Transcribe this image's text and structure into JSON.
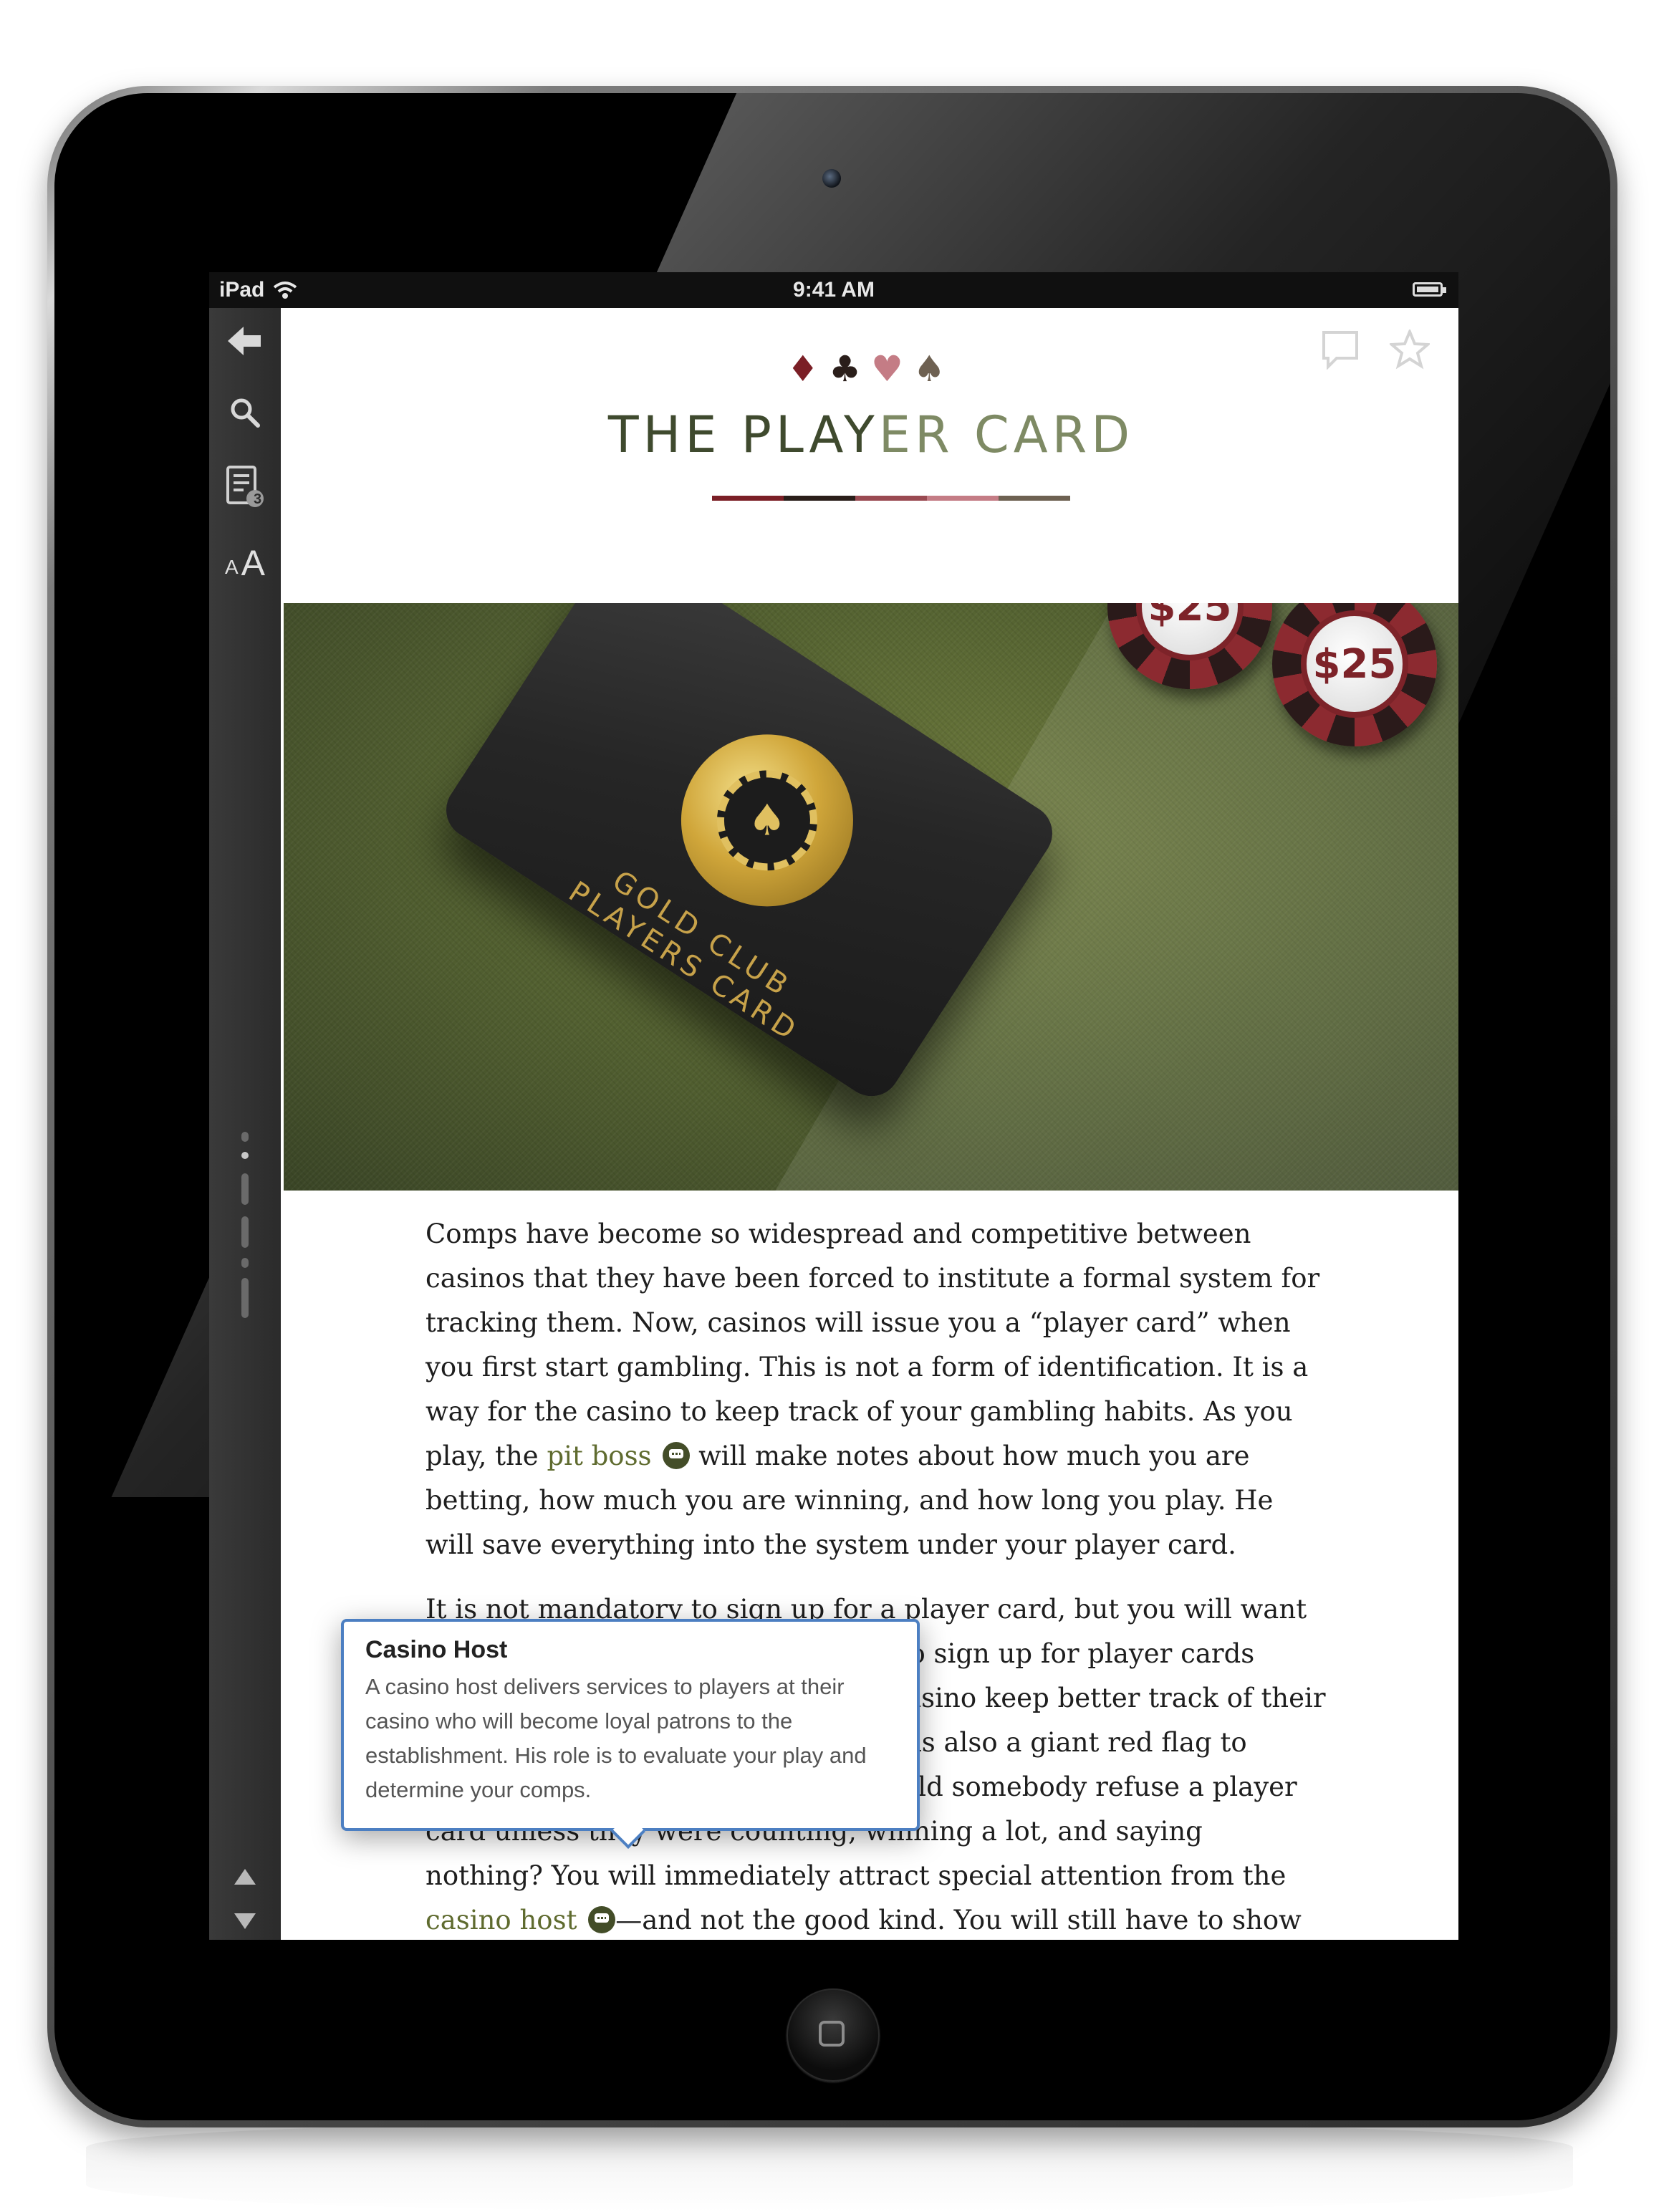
{
  "status_bar": {
    "device": "iPad",
    "time": "9:41 AM"
  },
  "toolbar": {
    "back_icon": "arrow-left-icon",
    "search_icon": "search-icon",
    "notes_badge": "3",
    "font_small": "A",
    "font_large": "A"
  },
  "article": {
    "suits": [
      "♦",
      "♣",
      "♥",
      "♠"
    ],
    "suit_colors": [
      "#7b1f26",
      "#2a1e1a",
      "#c47c85",
      "#6e6152"
    ],
    "title_part1": "THE PLAY",
    "title_part2": "ER CARD",
    "rule_colors": [
      "#7b1f26",
      "#2a1e1a",
      "#9a4a52",
      "#c47c85",
      "#6e6152"
    ],
    "hero": {
      "card_caption": "GOLD CLUB PLAYERS CARD",
      "chip_labels": [
        "$25",
        "$25"
      ]
    },
    "paragraph1": {
      "before_link": "Comps have become so widespread and competitive between casinos that they have been forced to institute a formal system for tracking them. Now, casinos will issue you a “player card” when you first start gambling. This is not a form of identification. It is a way for the casino to keep track of your gambling habits. As you play, the ",
      "link": "pit boss",
      "after_link": " will make notes about how much you are betting, how much you are winning, and how long you play. He will save everything into the system under your player card."
    },
    "paragraph2": {
      "before_link": "It is not mandatory to sign up for a player card, but you will want to. Many card counters don’t want to sign up for player cards because they think it will help the casino keep better track of their winnings. While this may be true, it is also a giant red flag to reject one. The question is, why would somebody refuse a player card unless they were counting, winning a lot, and saying nothing? You will immediately attract special attention from the ",
      "link": "casino host",
      "after_link": "—and not the good kind. You will still have to show your identification if they ask for it and they will still track your play even"
    }
  },
  "popover": {
    "title": "Casino Host",
    "body": "A casino host delivers services to players at their casino who will become loyal patrons to the establishment. His role is to evaluate your play and determine your comps."
  }
}
